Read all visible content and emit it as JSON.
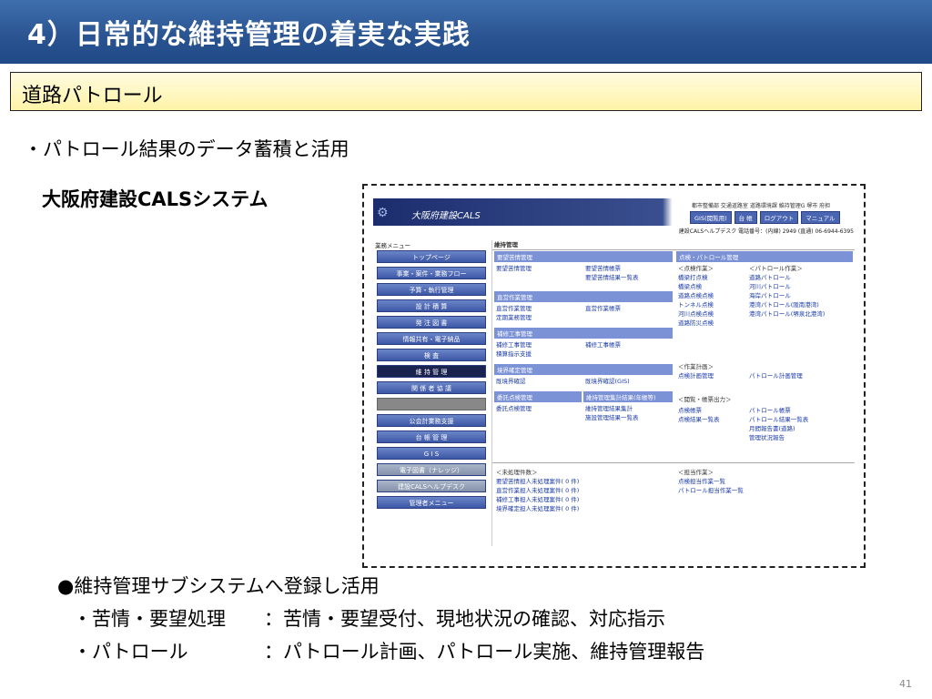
{
  "slide": {
    "title": "4）日常的な維持管理の着実な実践",
    "section": "道路パトロール",
    "bullet1": "・パトロール結果のデータ蓄積と活用",
    "system_title": "大阪府建設CALSシステム",
    "bullet2": "●維持管理サブシステムへ登録し活用",
    "line3_label": "・苦情・要望処理",
    "line3_value": "：苦情・要望受付、現地状況の確認、対応指示",
    "line4_label": "・パトロール",
    "line4_value": "：パトロール計画、パトロール実施、維持管理報告",
    "page_number": "41"
  },
  "screenshot": {
    "app_name": "大阪府建設CALS",
    "org_line": "都市整備部 交通道路室 道路環境課 維持管理G 堺市 府担",
    "header_buttons": [
      "GIS(閲覧用)",
      "台 帳",
      "ログアウト",
      "マニュアル"
    ],
    "help_line": "建設CALSヘルプデスク 電話番号：(内線) 2949 (直通) 06-6944-6395",
    "menu_label": "業務メニュー",
    "menu": [
      "トップページ",
      "事業・案件・業務フロー",
      "予算・執行管理",
      "設 計 積 算",
      "発 注 図 書",
      "情報共有・電子納品",
      "検 査",
      "維 持 管 理",
      "関 係 者 協 議",
      "",
      "公会計業務支援",
      "台 帳 管 理",
      "G I S",
      "電子図書（ナレッジ）",
      "建設CALSヘルプデスク",
      "管理者メニュー"
    ],
    "main_title": "維持管理",
    "left_sections": [
      {
        "title": "要望苦情管理",
        "col1": "要望苦情管理",
        "col2": "要望苦情帳票\n要望苦情結果一覧表"
      },
      {
        "title": "直営作業管理",
        "col1": "直営作業管理\n定期業務管理",
        "col2": "直営作業帳票"
      },
      {
        "title": "補修工事管理",
        "col1": "補修工事管理\n積算指示支援",
        "col2": "補修工事帳票"
      },
      {
        "title": "境界確定管理",
        "col1": "既境界確認",
        "col2": "既境界確認(GIS)"
      },
      {
        "title": "委託点検管理",
        "col1": "委託点検管理",
        "col2": ""
      }
    ],
    "maint_summary_title": "維持管理集計結果(年帳等)",
    "maint_summary_links": "維持管理結果集計\n施設管理結果一覧表",
    "right_title": "点検・パトロール管理",
    "right_block1_label": "＜点検作業＞",
    "right_block1_links": "橋梁打点検\n橋梁点検\n道路点検点検\nトンネル点検\n河川点検点検\n道路防災点検",
    "right_block2_label": "＜パトロール作業＞",
    "right_block2_links": "道路パトロール\n河川パトロール\n海岸パトロール\n港湾パトロール(阪南港湾)\n港湾パトロール(堺泉北港湾)",
    "right_block3_label": "＜作業計画＞",
    "right_block3_links": "点検計画管理",
    "right_block3_links2": "パトロール計画管理",
    "right_block4_label": "＜閲覧・帳票出力＞",
    "right_block4_links": "点検帳票\n点検結果一覧表",
    "right_block4_links2": "パトロール帳票\nパトロール結果一覧表\n月間報告書(道路)\n管理状況報告",
    "unprocessed_label": "＜未処理件数＞",
    "unprocessed_links": "要望苦情担人未処理案件( 0 件)\n直営作業担人未処理案件( 0 件)\n補修工事担人未処理案件( 0 件)\n境界確定担人未処理案件( 0 件)",
    "assigned_label": "＜担当作業＞",
    "assigned_links": "点検担当作業一覧\nパトロール担当作業一覧"
  }
}
